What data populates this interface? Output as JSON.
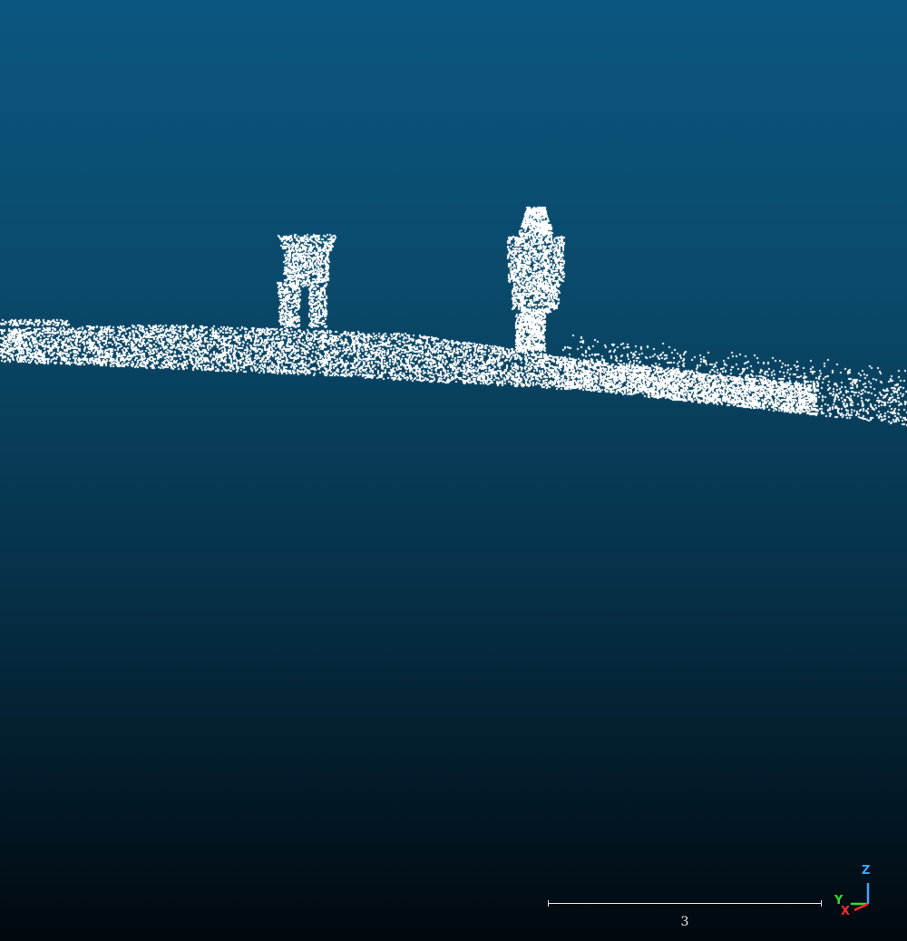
{
  "viewer": {
    "background_top": "#0b5680",
    "background_bottom": "#01080d",
    "point_color": "#ffffff"
  },
  "scale_bar": {
    "label": "3"
  },
  "axes": {
    "x_label": "X",
    "y_label": "Y",
    "z_label": "Z",
    "x_color": "#ff2a2a",
    "y_color": "#2fe02f",
    "z_color": "#3aa7ff"
  }
}
